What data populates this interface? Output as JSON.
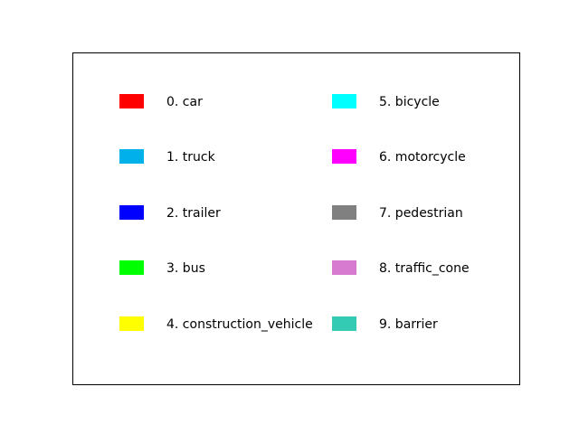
{
  "chart_data": {
    "type": "legend",
    "entries": [
      {
        "label": "0. car",
        "color": "#ff0000"
      },
      {
        "label": "1. truck",
        "color": "#00b0e8"
      },
      {
        "label": "2. trailer",
        "color": "#0000ff"
      },
      {
        "label": "3. bus",
        "color": "#00ff00"
      },
      {
        "label": "4. construction_vehicle",
        "color": "#ffff00"
      },
      {
        "label": "5. bicycle",
        "color": "#00ffff"
      },
      {
        "label": "6. motorcycle",
        "color": "#ff00ff"
      },
      {
        "label": "7. pedestrian",
        "color": "#808080"
      },
      {
        "label": "8. traffic_cone",
        "color": "#d67bd0"
      },
      {
        "label": "9. barrier",
        "color": "#33ccb3"
      }
    ]
  }
}
